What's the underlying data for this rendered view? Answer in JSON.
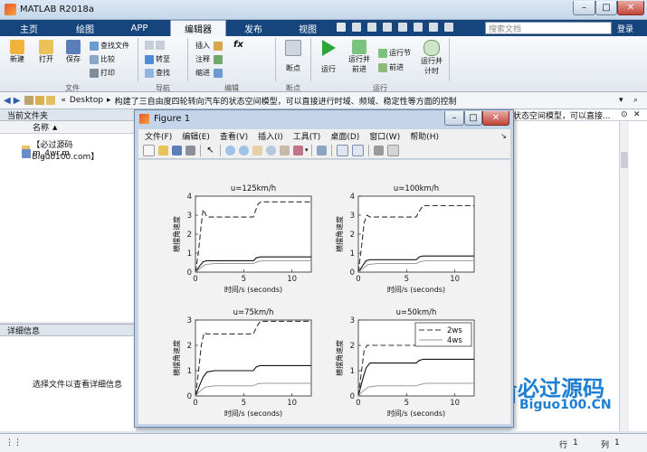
{
  "window": {
    "title": "MATLAB R2018a"
  },
  "tabs": [
    "主页",
    "绘图",
    "APP",
    "编辑器",
    "发布",
    "视图"
  ],
  "active_tab": "编辑器",
  "search": {
    "placeholder": "搜索文档"
  },
  "login": "登录",
  "ribbon": {
    "file_group": {
      "label": "文件",
      "new": "新建",
      "open": "打开",
      "save": "保存",
      "find_files": "查找文件",
      "compare": "比较",
      "print": "打印"
    },
    "nav_group": {
      "label": "导航",
      "goto": "转至",
      "find": "查找"
    },
    "edit_group": {
      "label": "编辑",
      "insert": "插入",
      "comment": "注释",
      "indent": "缩进",
      "fx": "fx"
    },
    "breakpoint_group": {
      "label": "断点",
      "breakpoints": "断点"
    },
    "run_group": {
      "label": "运行",
      "run": "运行",
      "run_advance": "运行并前进",
      "run_section": "运行节",
      "advance": "前进",
      "run_time": "运行并计时"
    }
  },
  "path": {
    "root": "«",
    "folder": "Desktop",
    "sep": "▸",
    "current": "构建了三自由度四轮转向汽车的状态空间模型，可以直接进行时域、频域、稳定性等方面的控制"
  },
  "file_panel": {
    "title": "当前文件夹",
    "column": "名称",
    "sort": "▲",
    "files": [
      "【必过源码 Biguo100.com】",
      "m_4wr.m"
    ]
  },
  "detail_panel": {
    "title": "详细信息",
    "message": "选择文件以查看详细信息"
  },
  "right_panel": {
    "text": "状态空间模型，可以直接..."
  },
  "status": {
    "row_label": "行",
    "row": "1",
    "col_label": "列",
    "col": "1"
  },
  "figure": {
    "title": "Figure 1",
    "menu": [
      "文件(F)",
      "编辑(E)",
      "查看(V)",
      "插入(I)",
      "工具(T)",
      "桌面(D)",
      "窗口(W)",
      "帮助(H)"
    ]
  },
  "colors": {
    "tab_bar": "#16457e",
    "figure_frame": "#c4d5ea",
    "logo_blue": "#1c7fd4"
  },
  "watermark": {
    "title": "必过源码",
    "url": "Biguo100.CN"
  },
  "chart_data": [
    {
      "type": "line",
      "title": "u=125km/h",
      "xlabel": "时间/s (seconds)",
      "ylabel": "横摆角速度",
      "xlim": [
        0,
        12
      ],
      "ylim": [
        0,
        4
      ],
      "xticks": [
        0,
        5,
        10
      ],
      "yticks": [
        0,
        1,
        2,
        3,
        4
      ],
      "series": [
        {
          "style": "dashed",
          "x": [
            0,
            0.3,
            0.6,
            0.8,
            1.0,
            1.2,
            1.6,
            2.2,
            6.0,
            6.2,
            6.5,
            6.8,
            7.5,
            12
          ],
          "y": [
            0,
            1.0,
            2.5,
            3.3,
            3.1,
            2.9,
            2.9,
            2.9,
            2.9,
            3.2,
            3.6,
            3.7,
            3.7,
            3.7
          ]
        },
        {
          "style": "solid",
          "x": [
            0,
            0.4,
            0.8,
            1.2,
            2.0,
            6.0,
            6.3,
            6.7,
            12
          ],
          "y": [
            0,
            0.3,
            0.55,
            0.6,
            0.6,
            0.6,
            0.75,
            0.8,
            0.8
          ]
        },
        {
          "style": "solid-gray",
          "x": [
            0,
            0.5,
            1.0,
            2.0,
            6.0,
            6.4,
            7.0,
            12
          ],
          "y": [
            0,
            0.2,
            0.4,
            0.45,
            0.45,
            0.55,
            0.6,
            0.6
          ]
        }
      ]
    },
    {
      "type": "line",
      "title": "u=100km/h",
      "xlabel": "时间/s (seconds)",
      "ylabel": "横摆角速度",
      "xlim": [
        0,
        12
      ],
      "ylim": [
        0,
        4
      ],
      "xticks": [
        0,
        5,
        10
      ],
      "yticks": [
        0,
        1,
        2,
        3,
        4
      ],
      "series": [
        {
          "style": "dashed",
          "x": [
            0,
            0.3,
            0.6,
            0.9,
            1.2,
            1.6,
            6.0,
            6.3,
            6.7,
            7.5,
            12
          ],
          "y": [
            0,
            1.2,
            2.6,
            3.0,
            2.9,
            2.9,
            2.9,
            3.2,
            3.5,
            3.5,
            3.5
          ]
        },
        {
          "style": "solid",
          "x": [
            0,
            0.4,
            0.8,
            1.2,
            2.0,
            6.0,
            6.3,
            6.7,
            12
          ],
          "y": [
            0,
            0.3,
            0.6,
            0.65,
            0.65,
            0.65,
            0.8,
            0.85,
            0.85
          ]
        },
        {
          "style": "solid-gray",
          "x": [
            0,
            0.5,
            1.0,
            2.0,
            6.0,
            6.4,
            7.0,
            12
          ],
          "y": [
            0,
            0.2,
            0.4,
            0.45,
            0.45,
            0.55,
            0.6,
            0.6
          ]
        }
      ]
    },
    {
      "type": "line",
      "title": "u=75km/h",
      "xlabel": "时间/s (seconds)",
      "ylabel": "横摆角速度",
      "xlim": [
        0,
        12
      ],
      "ylim": [
        0,
        3
      ],
      "xticks": [
        0,
        5,
        10
      ],
      "yticks": [
        0,
        1,
        2,
        3
      ],
      "series": [
        {
          "style": "dashed",
          "x": [
            0,
            0.3,
            0.6,
            0.9,
            1.2,
            1.6,
            6.0,
            6.3,
            6.7,
            7.5,
            12
          ],
          "y": [
            0,
            0.9,
            2.0,
            2.5,
            2.45,
            2.45,
            2.45,
            2.7,
            2.95,
            2.95,
            2.95
          ]
        },
        {
          "style": "solid",
          "x": [
            0,
            0.4,
            0.8,
            1.2,
            2.0,
            6.0,
            6.3,
            6.7,
            12
          ],
          "y": [
            0,
            0.4,
            0.75,
            0.95,
            1.0,
            1.0,
            1.15,
            1.2,
            1.2
          ]
        },
        {
          "style": "solid-gray",
          "x": [
            0,
            0.5,
            1.0,
            2.0,
            6.0,
            6.4,
            7.0,
            12
          ],
          "y": [
            0,
            0.2,
            0.35,
            0.4,
            0.4,
            0.48,
            0.5,
            0.5
          ]
        }
      ]
    },
    {
      "type": "line",
      "title": "u=50km/h",
      "xlabel": "时间/s (seconds)",
      "ylabel": "横摆角速度",
      "xlim": [
        0,
        12
      ],
      "ylim": [
        0,
        3
      ],
      "xticks": [
        0,
        5,
        10
      ],
      "yticks": [
        0,
        1,
        2,
        3
      ],
      "legend": {
        "placement": "top-right",
        "entries": [
          {
            "label": "2ws",
            "style": "dashed"
          },
          {
            "label": "4ws",
            "style": "solid-gray"
          }
        ]
      },
      "series": [
        {
          "name": "2ws",
          "style": "dashed",
          "x": [
            0,
            0.3,
            0.6,
            0.9,
            1.5,
            6.0,
            6.3,
            6.7,
            7.5,
            12
          ],
          "y": [
            0,
            0.9,
            1.8,
            2.0,
            2.0,
            2.0,
            2.15,
            2.3,
            2.3,
            2.3
          ]
        },
        {
          "style": "solid",
          "x": [
            0,
            0.4,
            0.8,
            1.2,
            2.0,
            6.0,
            6.3,
            6.7,
            12
          ],
          "y": [
            0,
            0.6,
            1.1,
            1.3,
            1.3,
            1.3,
            1.4,
            1.45,
            1.45
          ]
        },
        {
          "name": "4ws",
          "style": "solid-gray",
          "x": [
            0,
            0.5,
            1.0,
            2.0,
            6.0,
            6.4,
            7.0,
            12
          ],
          "y": [
            0,
            0.2,
            0.35,
            0.4,
            0.4,
            0.45,
            0.5,
            0.5
          ]
        }
      ]
    }
  ]
}
